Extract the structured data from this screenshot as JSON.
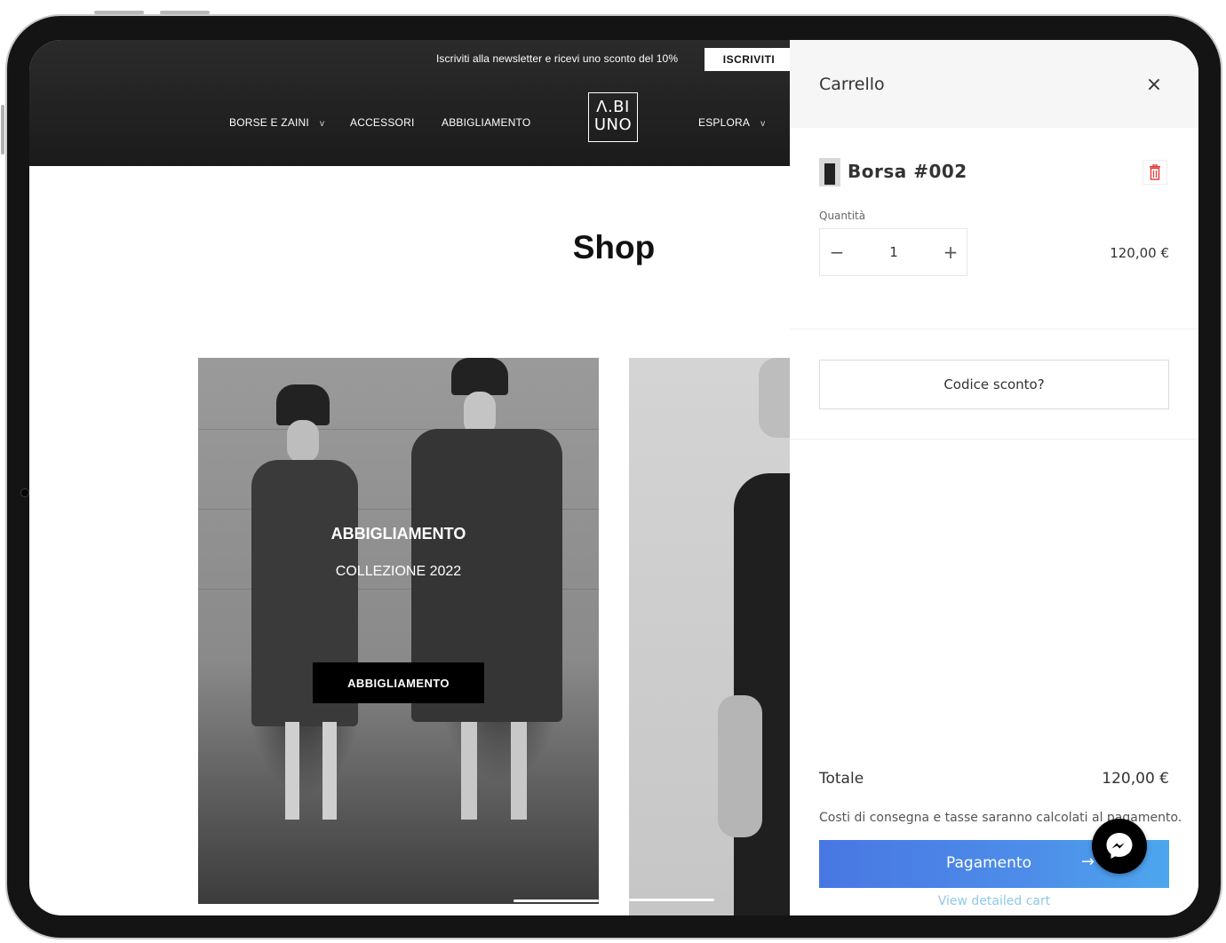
{
  "promo": {
    "text": "Iscriviti alla newsletter e ricevi uno sconto del 10%",
    "button": "ISCRIVITI"
  },
  "nav": {
    "borse": "BORSE E ZAINI",
    "accessori": "ACCESSORI",
    "abbigliamento": "ABBIGLIAMENTO",
    "esplora": "ESPLORA",
    "caret": "v"
  },
  "logo": {
    "line1": "Λ.BI",
    "line2": "UNO"
  },
  "page": {
    "title": "Shop"
  },
  "card": {
    "title": "ABBIGLIAMENTO",
    "subtitle": "COLLEZIONE 2022",
    "button": "ABBIGLIAMENTO"
  },
  "cart": {
    "title": "Carrello",
    "close": "×",
    "item": {
      "name": "Borsa #002",
      "quantity_label": "Quantità",
      "quantity": "1",
      "minus": "−",
      "plus": "+",
      "price": "120,00 €"
    },
    "coupon": "Codice sconto?",
    "total_label": "Totale",
    "total_value": "120,00 €",
    "note": "Costi di consegna e tasse saranno calcolati al pagamento.",
    "checkout": "Pagamento",
    "checkout_arrow": "→",
    "detailed_link": "View detailed cart"
  },
  "colors": {
    "checkout_start": "#4877e3",
    "checkout_end": "#4da6ee",
    "delete_icon": "#e53935",
    "link": "#8ec9e8"
  },
  "icons": {
    "delete": "trash-icon",
    "close": "close-icon",
    "chat": "messenger-icon"
  }
}
